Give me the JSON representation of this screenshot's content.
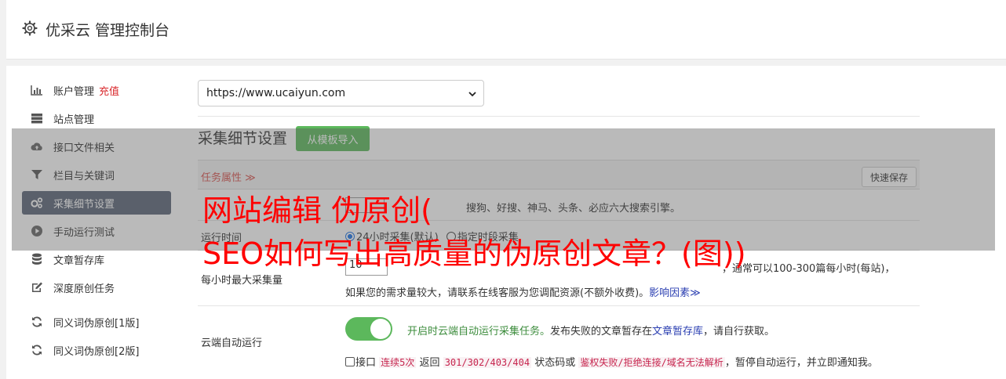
{
  "header": {
    "title": "优采云 管理控制台"
  },
  "sidebar": {
    "items": [
      {
        "label": "账户管理",
        "extra": "充值",
        "icon": "bar-chart-icon"
      },
      {
        "label": "站点管理",
        "icon": "server-icon"
      },
      {
        "label": "接口文件相关",
        "icon": "cloud-upload-icon"
      },
      {
        "label": "栏目与关键词",
        "icon": "filter-icon"
      },
      {
        "label": "采集细节设置",
        "icon": "gears-icon",
        "active": true
      },
      {
        "label": "手动运行测试",
        "icon": "play-circle-icon"
      },
      {
        "label": "文章暂存库",
        "icon": "database-icon"
      },
      {
        "label": "深度原创任务",
        "icon": "edit-icon"
      },
      {
        "label": "同义词伪原创[1版]",
        "icon": "refresh-icon"
      },
      {
        "label": "同义词伪原创[2版]",
        "icon": "refresh-icon"
      }
    ]
  },
  "site_select": {
    "value": "https://www.ucaiyun.com"
  },
  "section": {
    "title": "采集细节设置",
    "import_button": "从模板导入"
  },
  "props_bar": {
    "tab": "任务属性 ≫",
    "save_button": "快速保存"
  },
  "rows": {
    "row1_text": "搜狗、好搜、神马、头条、必应六大搜索引擎。",
    "run_time": {
      "label": "运行时间",
      "opt1": "24小时采集(默认)",
      "opt2": "指定时段采集"
    },
    "max_collect": {
      "label": "每小时最大采集量",
      "value": "10",
      "text_right": "，通常可以100-300篇每小时(每站)，",
      "text_line2": "如果您的需求量较大，请联系在线客服为您调配资源(不额外收费)。",
      "link": "影响因素≫"
    },
    "cloud_run": {
      "label": "云端自动运行",
      "desc_green": "开启时云端自动运行采集任务。",
      "desc": "发布失败的文章暂存在",
      "desc_link": "文章暂存库",
      "desc_end": "，请自行获取。",
      "c_interface": "接口",
      "c_code1": "连续5次",
      "c_return": "返回",
      "c_code2": "301/302/403/404",
      "c_status": "状态码或",
      "c_code3": "鉴权失败/拒绝连接/域名无法解析",
      "c_end": "，暂停自动运行，并立即通知我。"
    }
  },
  "overlay": {
    "line1": "网站编辑 伪原创(",
    "line2": "SEO如何写出高质量的伪原创文章？(图))"
  },
  "colors": {
    "accent_green": "#5cb85c",
    "active_nav": "#5a6578",
    "overlay_red": "#ff0000",
    "link_blue": "#2a3eb1"
  }
}
